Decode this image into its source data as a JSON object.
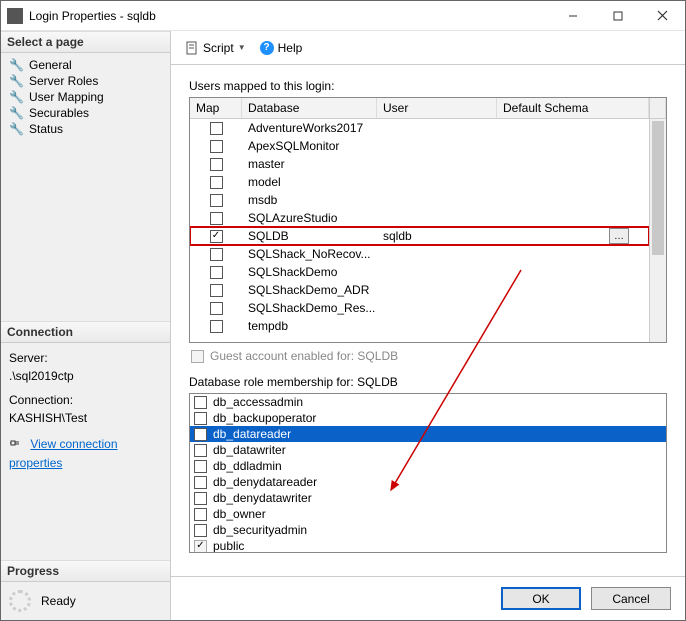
{
  "window": {
    "title": "Login Properties - sqldb"
  },
  "toolbar": {
    "script": "Script",
    "help": "Help"
  },
  "nav": {
    "header": "Select a page",
    "items": [
      "General",
      "Server Roles",
      "User Mapping",
      "Securables",
      "Status"
    ]
  },
  "connection": {
    "header": "Connection",
    "server_label": "Server:",
    "server": ".\\sql2019ctp",
    "conn_label": "Connection:",
    "conn": "KASHISH\\Test",
    "view_props": "View connection properties"
  },
  "progress": {
    "header": "Progress",
    "status": "Ready"
  },
  "users_label": "Users mapped to this login:",
  "grid": {
    "headers": {
      "map": "Map",
      "db": "Database",
      "user": "User",
      "schema": "Default Schema"
    },
    "rows": [
      {
        "checked": false,
        "db": "AdventureWorks2017",
        "user": "",
        "highlight": false
      },
      {
        "checked": false,
        "db": "ApexSQLMonitor",
        "user": "",
        "highlight": false
      },
      {
        "checked": false,
        "db": "master",
        "user": "",
        "highlight": false
      },
      {
        "checked": false,
        "db": "model",
        "user": "",
        "highlight": false
      },
      {
        "checked": false,
        "db": "msdb",
        "user": "",
        "highlight": false
      },
      {
        "checked": false,
        "db": "SQLAzureStudio",
        "user": "",
        "highlight": false
      },
      {
        "checked": true,
        "db": "SQLDB",
        "user": "sqldb",
        "highlight": true,
        "ellipsis": true
      },
      {
        "checked": false,
        "db": "SQLShack_NoRecov...",
        "user": "",
        "highlight": false
      },
      {
        "checked": false,
        "db": "SQLShackDemo",
        "user": "",
        "highlight": false
      },
      {
        "checked": false,
        "db": "SQLShackDemo_ADR",
        "user": "",
        "highlight": false
      },
      {
        "checked": false,
        "db": "SQLShackDemo_Res...",
        "user": "",
        "highlight": false
      },
      {
        "checked": false,
        "db": "tempdb",
        "user": "",
        "highlight": false
      }
    ]
  },
  "guest": "Guest account enabled for: SQLDB",
  "roles_label": "Database role membership for: SQLDB",
  "roles": [
    {
      "name": "db_accessadmin",
      "checked": false,
      "selected": false
    },
    {
      "name": "db_backupoperator",
      "checked": false,
      "selected": false
    },
    {
      "name": "db_datareader",
      "checked": true,
      "selected": true
    },
    {
      "name": "db_datawriter",
      "checked": false,
      "selected": false
    },
    {
      "name": "db_ddladmin",
      "checked": false,
      "selected": false
    },
    {
      "name": "db_denydatareader",
      "checked": false,
      "selected": false
    },
    {
      "name": "db_denydatawriter",
      "checked": false,
      "selected": false
    },
    {
      "name": "db_owner",
      "checked": false,
      "selected": false
    },
    {
      "name": "db_securityadmin",
      "checked": false,
      "selected": false
    },
    {
      "name": "public",
      "checked": true,
      "selected": false,
      "disabled": true
    }
  ],
  "footer": {
    "ok": "OK",
    "cancel": "Cancel"
  }
}
